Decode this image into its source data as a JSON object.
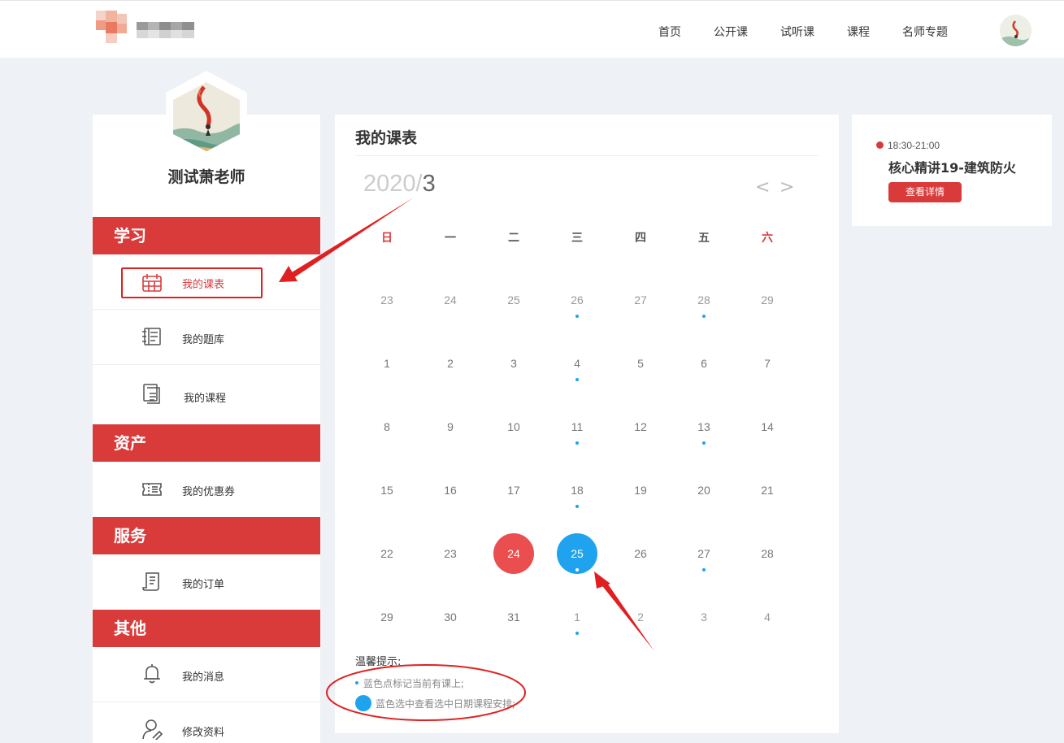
{
  "header": {
    "nav": [
      "首页",
      "公开课",
      "试听课",
      "课程",
      "名师专题"
    ]
  },
  "sidebar": {
    "teacher_name": "测试萧老师",
    "sections": [
      "学习",
      "资产",
      "服务",
      "其他"
    ],
    "items": [
      {
        "label": "我的课表",
        "icon": "calendar-icon",
        "active": true
      },
      {
        "label": "我的题库",
        "icon": "notebook-icon"
      },
      {
        "label": "我的课程",
        "icon": "document-icon"
      },
      {
        "label": "我的优惠券",
        "icon": "ticket-icon"
      },
      {
        "label": "我的订单",
        "icon": "receipt-icon"
      },
      {
        "label": "我的消息",
        "icon": "bell-icon"
      },
      {
        "label": "修改资料",
        "icon": "user-edit-icon"
      }
    ]
  },
  "calendar": {
    "title": "我的课表",
    "year": "2020/",
    "month": "3",
    "prev_label": "<",
    "next_label": ">",
    "weekdays": [
      "日",
      "一",
      "二",
      "三",
      "四",
      "五",
      "六"
    ],
    "weeks": [
      [
        "23",
        "24",
        "25",
        "26",
        "27",
        "28",
        "29"
      ],
      [
        "1",
        "2",
        "3",
        "4",
        "5",
        "6",
        "7"
      ],
      [
        "8",
        "9",
        "10",
        "11",
        "12",
        "13",
        "14"
      ],
      [
        "15",
        "16",
        "17",
        "18",
        "19",
        "20",
        "21"
      ],
      [
        "22",
        "23",
        "24",
        "25",
        "26",
        "27",
        "28"
      ],
      [
        "29",
        "30",
        "31",
        "1",
        "2",
        "3",
        "4"
      ]
    ],
    "today": "24",
    "selected": "25",
    "tips_title": "温馨提示:",
    "tip1": "蓝色点标记当前有课上;",
    "tip2": "蓝色选中查看选中日期课程安排;"
  },
  "schedule_card": {
    "time": "18:30-21:00",
    "title": "核心精讲19-建筑防火",
    "button": "查看详情"
  },
  "colors": {
    "brand_red": "#d93b3b",
    "today_red": "#ea4e4e",
    "select_blue": "#1fa3ee",
    "annotation_red": "#e02020"
  }
}
